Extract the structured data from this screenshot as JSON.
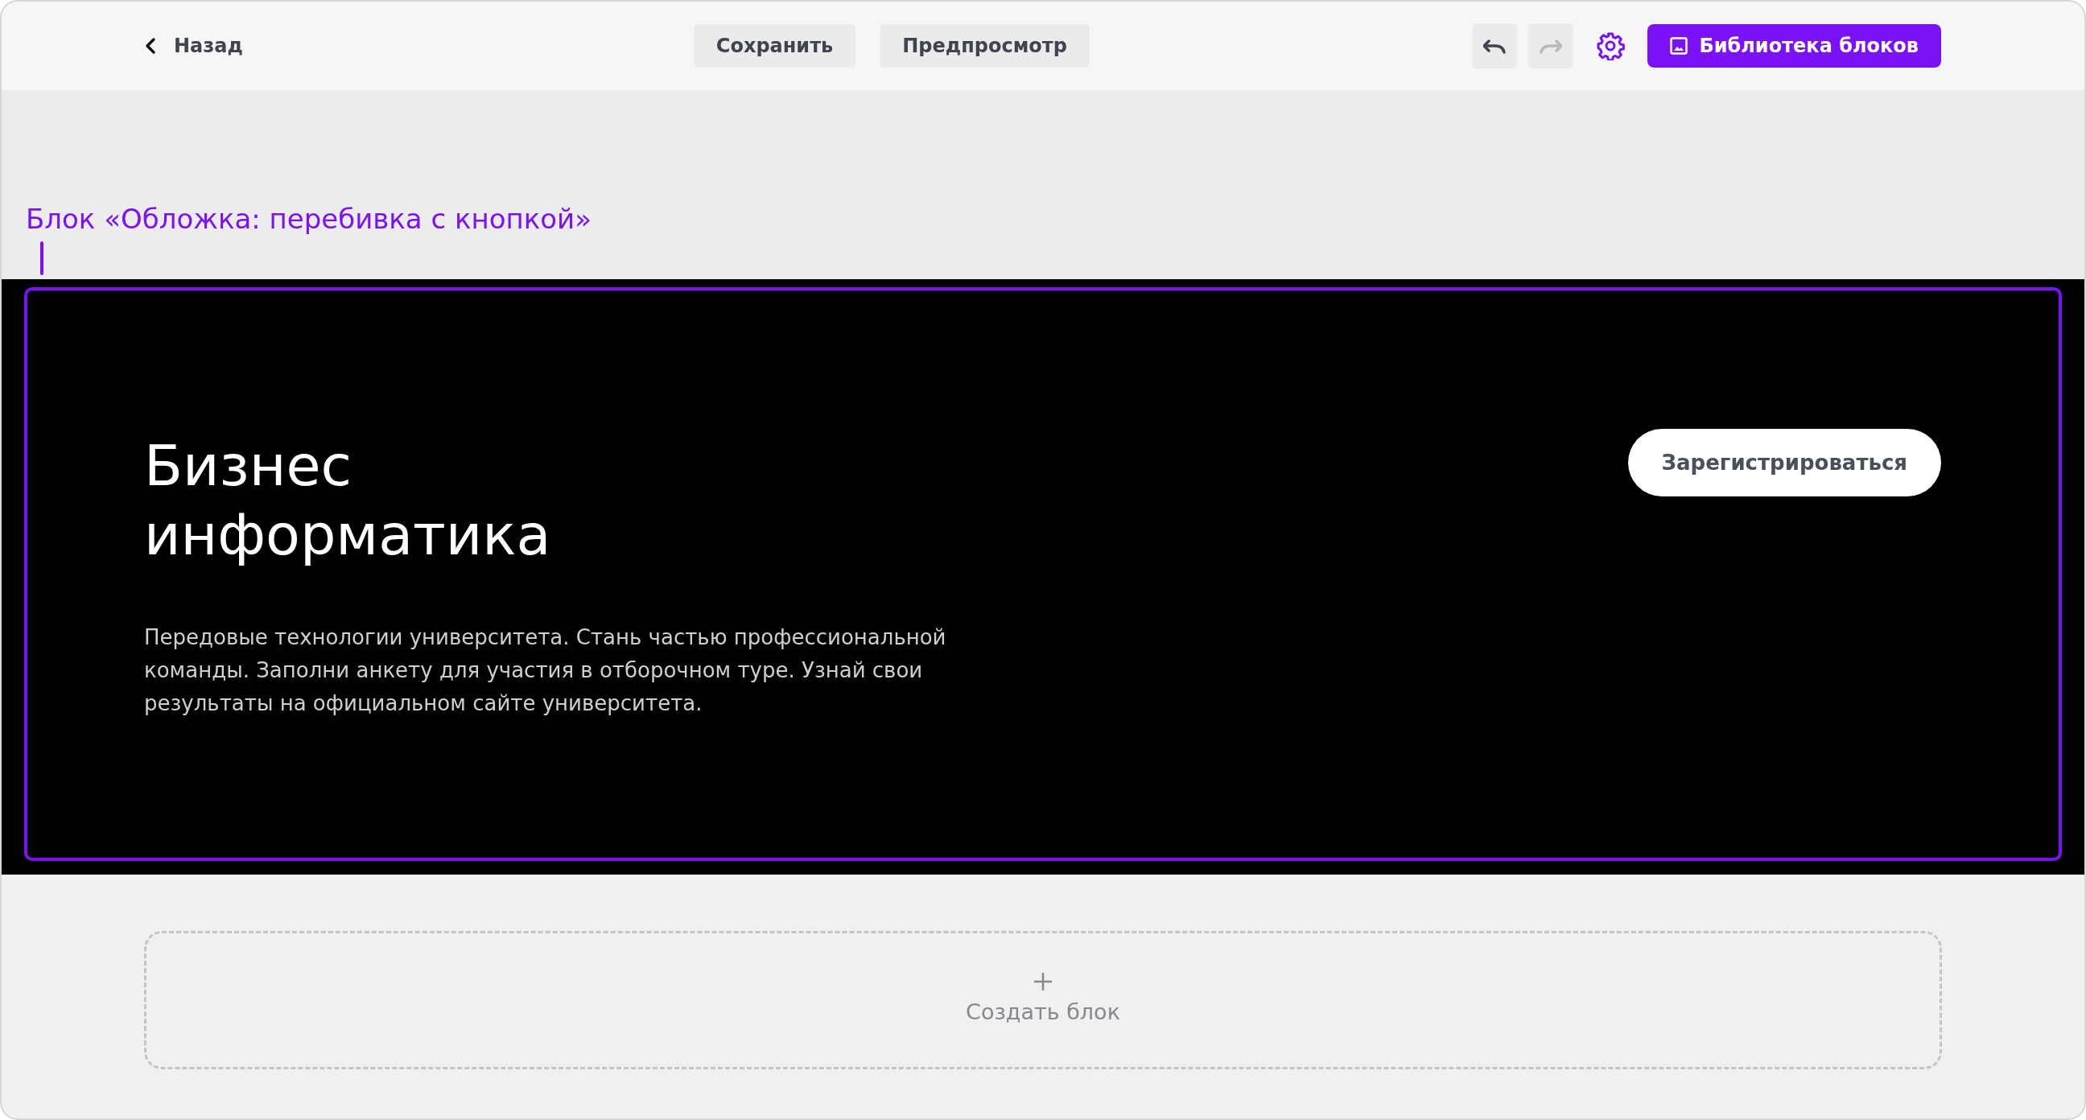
{
  "toolbar": {
    "back": "Назад",
    "buttons": [
      {
        "label": "Сохранить"
      },
      {
        "label": "Предпросмотр"
      }
    ],
    "history": [
      {
        "kind": "undo",
        "disabled": false
      },
      {
        "kind": "redo",
        "disabled": true
      }
    ],
    "library_button": "Библиотека блоков"
  },
  "block": {
    "label": "Блок «Обложка: перебивка с кнопкой»",
    "selected": true,
    "title": "Бизнес информатика",
    "text": "Передовые технологии университета. Стань частью профессиональной команды. Заполни анкету для участия в отборочном туре. Узнай свои результаты на официальном сайте университета.",
    "cta": "Зарегистрироваться"
  },
  "add_block": {
    "label": "Создать блок"
  }
}
